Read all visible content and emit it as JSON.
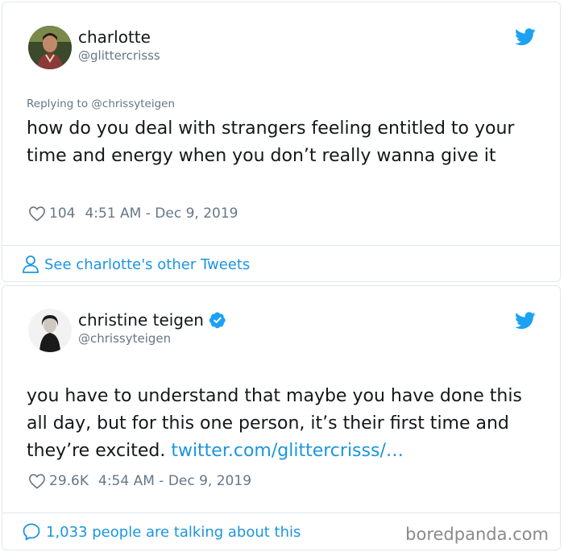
{
  "tweet1": {
    "name": "charlotte",
    "handle": "@glittercrisss",
    "replying_to": "Replying to @chrissyteigen",
    "text": "how do you deal with strangers feeling entitled to your time and energy when you don’t really wanna give it",
    "likes": "104",
    "timestamp": "4:51 AM - Dec 9, 2019",
    "footer_link": "See charlotte's other Tweets"
  },
  "tweet2": {
    "name": "christine teigen",
    "handle": "@chrissyteigen",
    "text": "you have to understand that maybe you have done this all day, but for this one person, it’s their first time and they’re excited.",
    "link": "twitter.com/glittercrisss/…",
    "likes": "29.6K",
    "timestamp": "4:54 AM - Dec 9, 2019",
    "footer_link": "1,033 people are talking about this"
  },
  "watermark": "boredpanda.com",
  "colors": {
    "accent": "#1b95e0",
    "twitter_blue": "#1da1f2",
    "muted": "#657786",
    "border": "#e1e8ed"
  },
  "icons": [
    "twitter-bird-icon",
    "heart-icon",
    "person-icon",
    "verified-badge-icon",
    "comment-bubble-icon"
  ]
}
